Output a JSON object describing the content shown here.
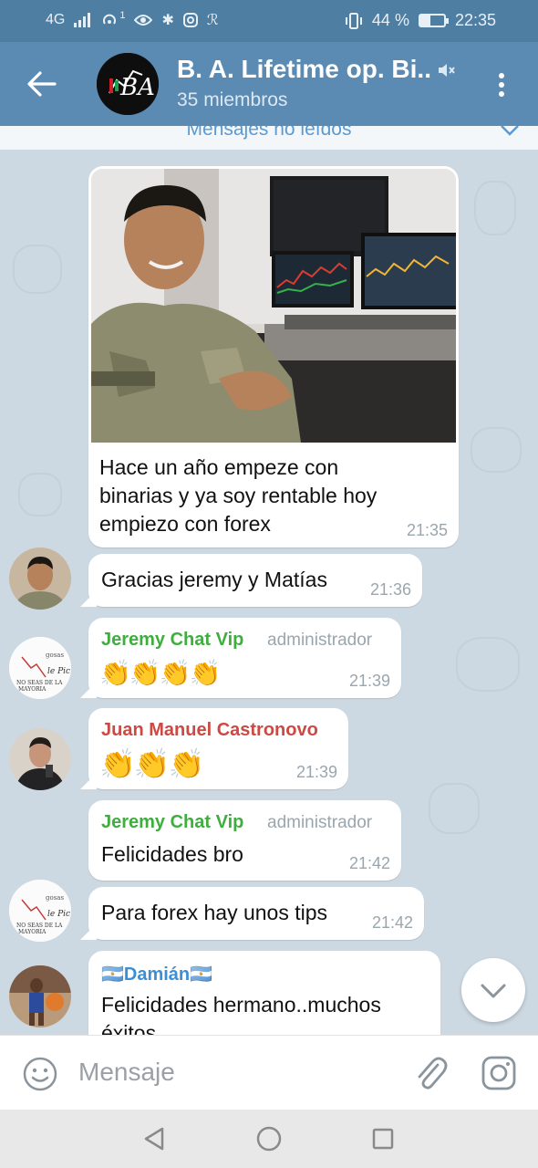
{
  "status_bar": {
    "network": "4G",
    "notif_count": "1",
    "battery": "44 %",
    "battery_level": 0.44,
    "time": "22:35"
  },
  "header": {
    "title": "B. A. Lifetime op. Bi...",
    "subtitle": "35 miembros"
  },
  "unread_label": "Mensajes no leídos",
  "messages": [
    {
      "text": "Hace un año empeze con binarias y ya soy rentable hoy empiezo con forex",
      "time": "21:35"
    },
    {
      "text": "Gracias jeremy y Matías",
      "time": "21:36"
    },
    {
      "sender": "Jeremy Chat Vip",
      "role": "administrador",
      "text": "👏👏👏👏",
      "time": "21:39"
    },
    {
      "sender": "Juan Manuel Castronovo",
      "text": "👏👏👏",
      "time": "21:39"
    },
    {
      "sender": "Jeremy Chat Vip",
      "role": "administrador",
      "text": "Felicidades bro",
      "time": "21:42"
    },
    {
      "text": "Para forex hay unos tips",
      "time": "21:42"
    },
    {
      "sender": "🇦🇷Damián🇦🇷",
      "text": "Felicidades hermano..muchos éxitos"
    }
  ],
  "input": {
    "placeholder": "Mensaje"
  },
  "colors": {
    "header_bg": "#5b8bb3",
    "admin_name": "#3fae3f",
    "juan_name": "#cc4a43",
    "damian_name": "#3a8fd6",
    "accent": "#5a9bd4"
  }
}
